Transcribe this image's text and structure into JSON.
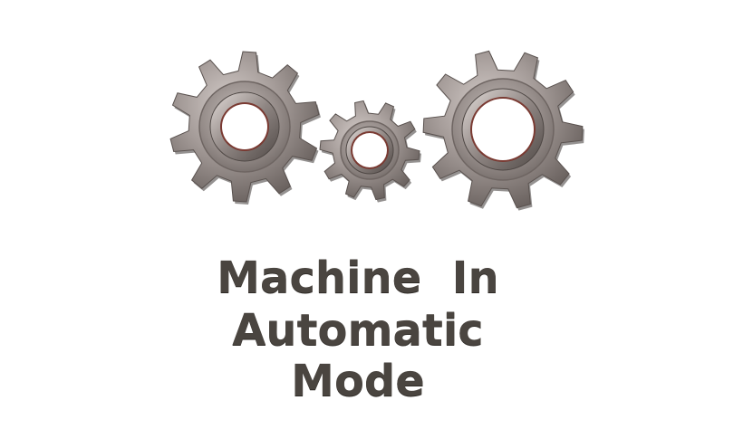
{
  "status_message": {
    "line1": "Machine  In",
    "line2": "Automatic",
    "line3": "Mode"
  },
  "icons": [
    "gear-icon-large-left",
    "gear-icon-small-center",
    "gear-icon-large-right"
  ],
  "colors": {
    "text": "#4a4540",
    "gear_light": "#b8b0ad",
    "gear_mid": "#8a817e",
    "gear_dark": "#5a524f",
    "gear_rim_accent": "#7a3a32",
    "background": "#ffffff"
  }
}
